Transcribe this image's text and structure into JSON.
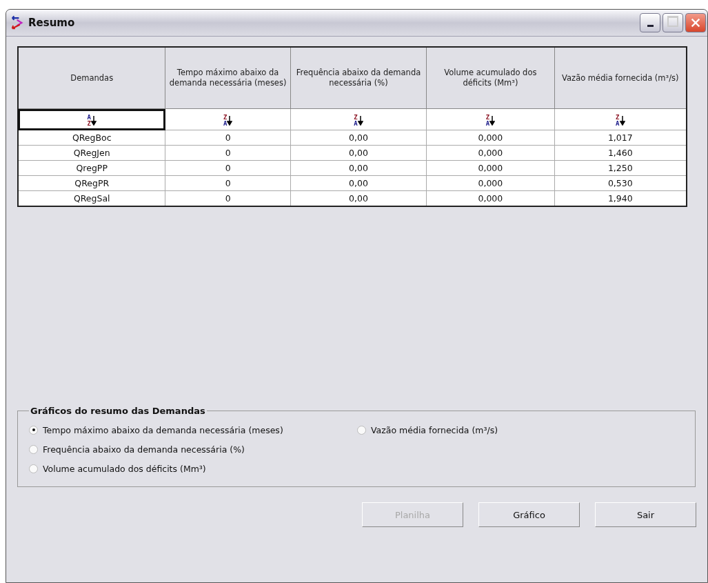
{
  "window": {
    "title": "Resumo"
  },
  "table": {
    "columns": [
      {
        "label": "Demandas",
        "sort_top": "A",
        "sort_bottom": "Z",
        "focused": true
      },
      {
        "label": "Tempo máximo abaixo da demanda necessária (meses)",
        "sort_top": "Z",
        "sort_bottom": "A",
        "focused": false
      },
      {
        "label": "Frequência abaixo da demanda necessária (%)",
        "sort_top": "Z",
        "sort_bottom": "A",
        "focused": false
      },
      {
        "label": "Volume acumulado dos déficits (Mm³)",
        "sort_top": "Z",
        "sort_bottom": "A",
        "focused": false
      },
      {
        "label": "Vazão média fornecida (m³/s)",
        "sort_top": "Z",
        "sort_bottom": "A",
        "focused": false
      }
    ],
    "rows": [
      [
        "QRegBoc",
        "0",
        "0,00",
        "0,000",
        "1,017"
      ],
      [
        "QRegJen",
        "0",
        "0,00",
        "0,000",
        "1,460"
      ],
      [
        "QregPP",
        "0",
        "0,00",
        "0,000",
        "1,250"
      ],
      [
        "QRegPR",
        "0",
        "0,00",
        "0,000",
        "0,530"
      ],
      [
        "QRegSal",
        "0",
        "0,00",
        "0,000",
        "1,940"
      ]
    ]
  },
  "chart_options": {
    "title": "Gráficos do resumo das Demandas",
    "options": [
      {
        "label": "Tempo máximo abaixo da demanda necessária (meses)",
        "selected": true
      },
      {
        "label": "Frequência abaixo da demanda necessária (%)",
        "selected": false
      },
      {
        "label": "Volume acumulado dos déficits (Mm³)",
        "selected": false
      },
      {
        "label": "Vazão média fornecida (m³/s)",
        "selected": false
      }
    ]
  },
  "buttons": [
    {
      "label": "Planilha",
      "disabled": true
    },
    {
      "label": "Gráfico",
      "disabled": false
    },
    {
      "label": "Sair",
      "disabled": false
    }
  ]
}
